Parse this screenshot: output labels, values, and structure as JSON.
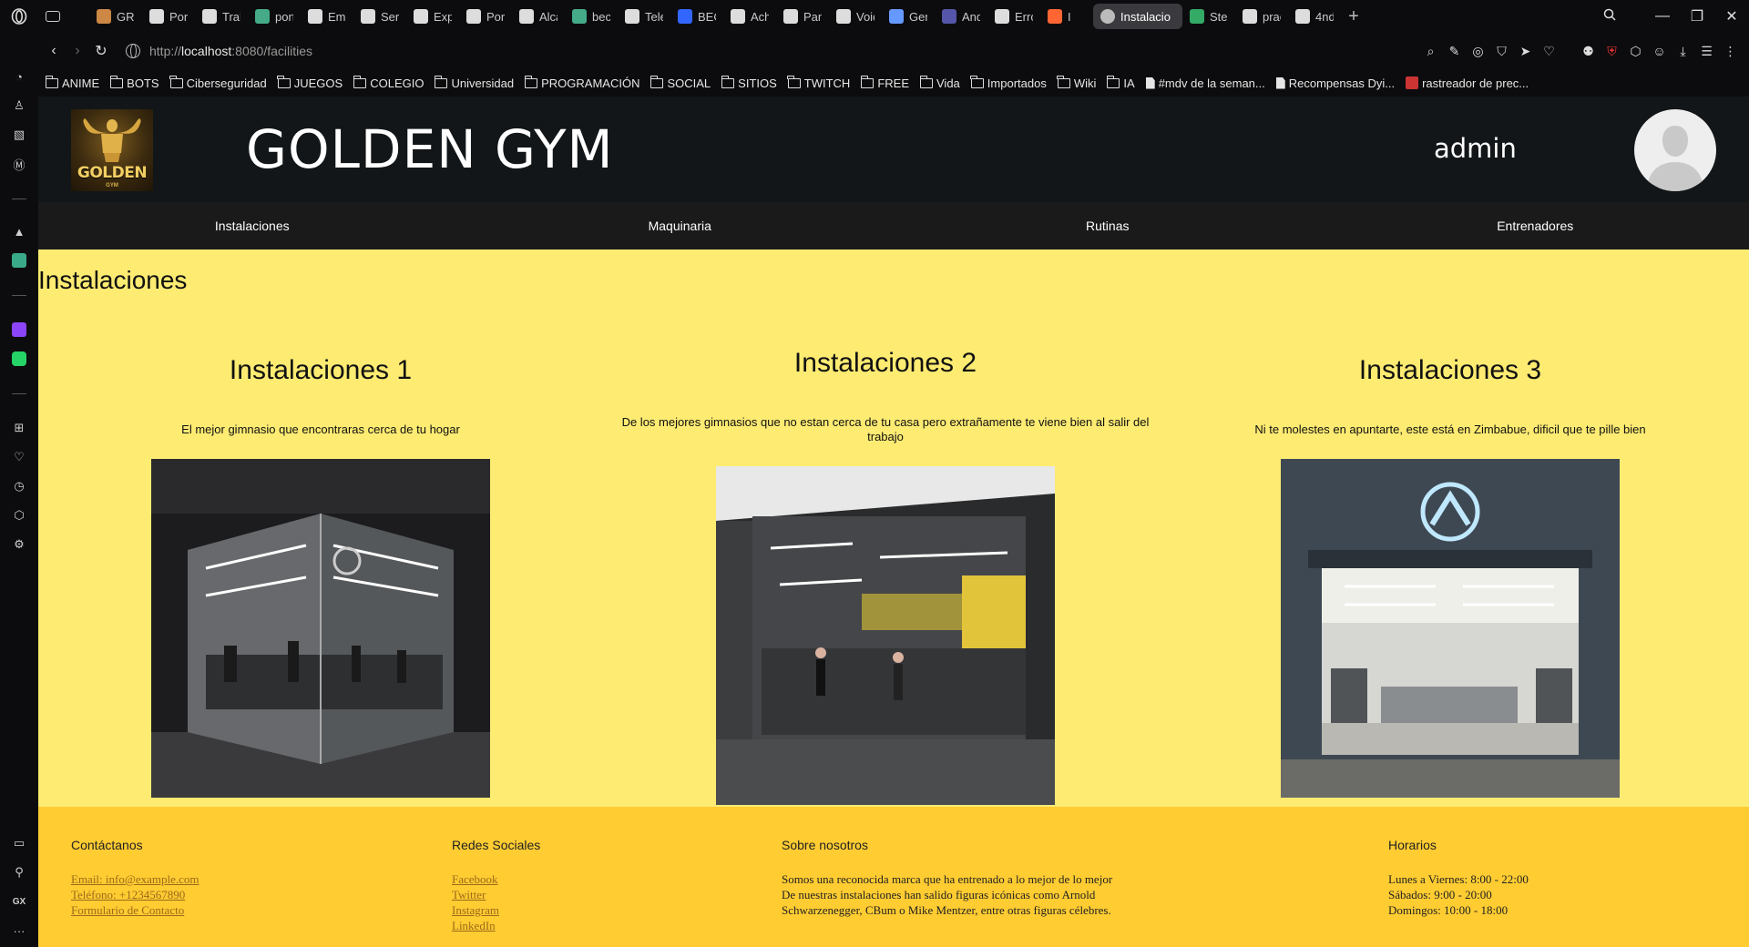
{
  "browser": {
    "tabs": [
      {
        "label": "GRU",
        "color": "#c84"
      },
      {
        "label": "Port",
        "color": "#ddd"
      },
      {
        "label": "Trab",
        "color": "#ddd"
      },
      {
        "label": "port",
        "color": "#4a8"
      },
      {
        "label": "Emp",
        "color": "#ddd"
      },
      {
        "label": "Serv",
        "color": "#ddd"
      },
      {
        "label": "Expe",
        "color": "#ddd"
      },
      {
        "label": "Port",
        "color": "#ddd"
      },
      {
        "label": "Alca",
        "color": "#ddd"
      },
      {
        "label": "beca",
        "color": "#4a8"
      },
      {
        "label": "Tele",
        "color": "#ddd"
      },
      {
        "label": "BEC",
        "color": "#36f"
      },
      {
        "label": "Achi",
        "color": "#ddd"
      },
      {
        "label": "Pant",
        "color": "#ddd"
      },
      {
        "label": "Void",
        "color": "#ddd"
      },
      {
        "label": "Gem",
        "color": "#69f"
      },
      {
        "label": "Andi",
        "color": "#55a"
      },
      {
        "label": "Erro",
        "color": "#ddd"
      },
      {
        "label": "I",
        "color": "#f63"
      }
    ],
    "active_tab": "Instalacio",
    "tabs_after": [
      {
        "label": "Stea",
        "color": "#3a6"
      },
      {
        "label": "prac",
        "color": "#ddd"
      },
      {
        "label": "4nd",
        "color": "#ddd"
      }
    ],
    "url_prefix": "http://",
    "url_host": "localhost",
    "url_path": ":8080/facilities",
    "bookmarks": [
      {
        "label": "ANIME",
        "kind": "folder"
      },
      {
        "label": "BOTS",
        "kind": "folder"
      },
      {
        "label": "Ciberseguridad",
        "kind": "folder"
      },
      {
        "label": "JUEGOS",
        "kind": "folder"
      },
      {
        "label": "COLEGIO",
        "kind": "folder"
      },
      {
        "label": "Universidad",
        "kind": "folder"
      },
      {
        "label": "PROGRAMACIÓN",
        "kind": "folder"
      },
      {
        "label": "SOCIAL",
        "kind": "folder"
      },
      {
        "label": "SITIOS",
        "kind": "folder"
      },
      {
        "label": "TWITCH",
        "kind": "folder"
      },
      {
        "label": "FREE",
        "kind": "folder"
      },
      {
        "label": "Vida",
        "kind": "folder"
      },
      {
        "label": "Importados",
        "kind": "folder"
      },
      {
        "label": "Wiki",
        "kind": "folder"
      },
      {
        "label": "IA",
        "kind": "folder"
      },
      {
        "label": "#mdv de la seman...",
        "kind": "doc"
      },
      {
        "label": "Recompensas Dyi...",
        "kind": "doc"
      },
      {
        "label": "rastreador de prec...",
        "kind": "fav"
      }
    ]
  },
  "site": {
    "title": "GOLDEN GYM",
    "logo_text": "GOLDEN",
    "logo_sub": "GYM",
    "username": "admin",
    "nav": [
      "Instalaciones",
      "Maquinaria",
      "Rutinas",
      "Entrenadores"
    ]
  },
  "page": {
    "heading": "Instalaciones",
    "facilities": [
      {
        "name": "Instalaciones 1",
        "description": "El mejor gimnasio que encontraras cerca de tu hogar"
      },
      {
        "name": "Instalaciones 2",
        "description": "De los mejores gimnasios que no estan cerca de tu casa pero extrañamente te viene bien al salir del trabajo"
      },
      {
        "name": "Instalaciones 3",
        "description": "Ni te molestes en apuntarte, este está en Zimbabue, dificil que te pille bien"
      }
    ]
  },
  "footer": {
    "contact": {
      "title": "Contáctanos",
      "email": "Email: info@example.com",
      "phone": "Teléfono: +1234567890",
      "form": "Formulario de Contacto"
    },
    "social": {
      "title": "Redes Sociales",
      "links": [
        "Facebook",
        "Twitter",
        "Instagram",
        "LinkedIn"
      ]
    },
    "about": {
      "title": "Sobre nosotros",
      "lines": [
        "Somos una reconocida marca que ha entrenado a lo mejor de lo mejor",
        "De nuestras instalaciones han salido figuras icónicas como Arnold",
        "Schwarzenegger, CBum o Mike Mentzer, entre otras figuras célebres."
      ]
    },
    "hours": {
      "title": "Horarios",
      "lines": [
        "Lunes a Viernes: 8:00 - 22:00",
        "Sábados: 9:00 - 20:00",
        "Domingos: 10:00 - 18:00"
      ]
    }
  }
}
